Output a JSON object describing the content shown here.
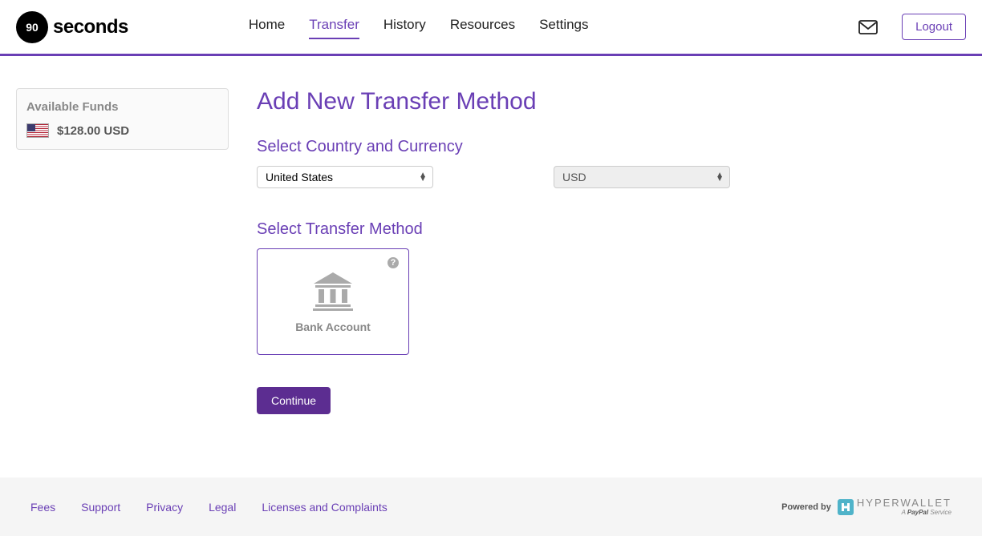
{
  "brand": {
    "logo_badge": "90",
    "logo_text": "seconds"
  },
  "nav": {
    "items": [
      {
        "label": "Home"
      },
      {
        "label": "Transfer",
        "active": true
      },
      {
        "label": "History"
      },
      {
        "label": "Resources"
      },
      {
        "label": "Settings"
      }
    ],
    "logout_label": "Logout"
  },
  "sidebar": {
    "funds_title": "Available Funds",
    "funds_amount": "$128.00 USD"
  },
  "main": {
    "title": "Add New Transfer Method",
    "section_country_currency": "Select Country and Currency",
    "country_selected": "United States",
    "currency_selected": "USD",
    "section_method": "Select Transfer Method",
    "method_card_label": "Bank Account",
    "continue_label": "Continue"
  },
  "footer": {
    "links": [
      {
        "label": "Fees"
      },
      {
        "label": "Support"
      },
      {
        "label": "Privacy"
      },
      {
        "label": "Legal"
      },
      {
        "label": "Licenses and Complaints"
      }
    ],
    "powered_by": "Powered by",
    "hyperwallet": "HYPERWALLET",
    "paypal_service": "A PayPal Service"
  }
}
